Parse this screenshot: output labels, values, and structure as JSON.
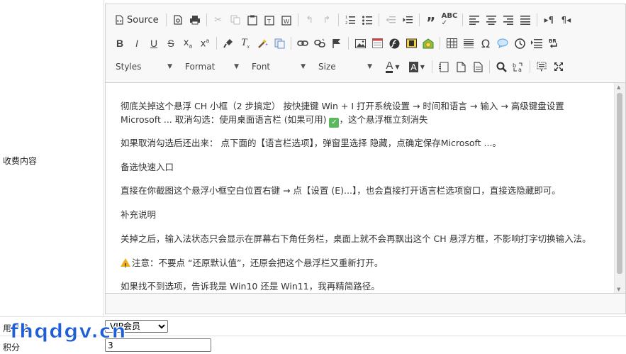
{
  "form": {
    "content_label": "收费内容",
    "user_label": "用户组",
    "user_select": {
      "selected": "VIP会员"
    },
    "points_label": "积分",
    "points_value": "3"
  },
  "toolbar": {
    "source_label": "Source",
    "styles_label": "Styles",
    "format_label": "Format",
    "font_label": "Font",
    "size_label": "Size",
    "icons_row1": [
      "preview-icon",
      "print-icon",
      "cut-icon",
      "copy-icon",
      "paste-icon",
      "paste-text-icon",
      "paste-word-icon",
      "undo-icon",
      "redo-icon",
      "numbered-list-icon",
      "bulleted-list-icon",
      "outdent-icon",
      "indent-icon",
      "blockquote-icon",
      "spellcheck-icon",
      "align-left-icon",
      "align-center-icon",
      "align-right-icon",
      "justify-icon",
      "ltr-icon",
      "rtl-icon"
    ],
    "icons_row2": [
      "bold-icon",
      "italic-icon",
      "underline-icon",
      "strike-icon",
      "subscript-icon",
      "superscript-icon",
      "copy-format-icon",
      "remove-format-icon",
      "magic-wand-icon",
      "template-icon",
      "link-icon",
      "unlink-icon",
      "anchor-flag-icon",
      "image-icon",
      "iframe-icon",
      "flash-icon",
      "flash-alt-icon",
      "smiley-icon",
      "table-icon",
      "horizontal-rule-icon",
      "special-char-icon",
      "speech-icon",
      "clock-icon",
      "page-break-icon",
      "bidi-icon"
    ]
  },
  "content": {
    "p1_a": "彻底关掉这个悬浮 CH 小框（2 步搞定） 按快捷键 Win + I 打开系统设置 → 时间和语言 → 输入 → 高级键盘设置",
    "p1_b": "Microsoft ... 取消勾选：使用桌面语言栏 (如果可用)",
    "p1_c": "，这个悬浮框立刻消失",
    "p2": "如果取消勾选后还出来： 点下面的【语言栏选项】，弹窗里选择 隐藏，点确定保存Microsoft ...。",
    "p3": "备选快速入口",
    "p4": "直接在你截图这个悬浮小框空白位置右键 → 点【设置 (E)...】，也会直接打开语言栏选项窗口，直接选隐藏即可。",
    "p5": "补充说明",
    "p6": "关掉之后，输入法状态只会显示在屏幕右下角任务栏，桌面上就不会再飘出这个 CH 悬浮方框，不影响打字切换输入法。",
    "p7": "注意：不要点 “还原默认值”，还原会把这个悬浮栏又重新打开。",
    "p8": "如果找不到选项，告诉我是 Win10 还是 Win11，我再精简路径。"
  },
  "watermark": "fhqdgv.cn"
}
